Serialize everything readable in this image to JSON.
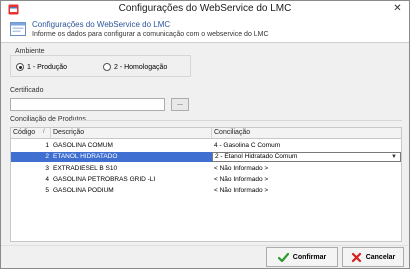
{
  "window": {
    "title": "Configurações do WebService do LMC",
    "close_glyph": "✕"
  },
  "header": {
    "title": "Configurações do WebService do LMC",
    "subtitle": "Informe os dados para configurar a comunicação com o webservice do LMC",
    "icon": "window-form-icon"
  },
  "ambiente": {
    "label": "Ambiente",
    "options": [
      {
        "label": "1 - Produção",
        "checked": true
      },
      {
        "label": "2 - Homologação",
        "checked": false
      }
    ]
  },
  "certificado": {
    "label": "Certificado",
    "value": "",
    "browse_label": "..."
  },
  "conciliacao": {
    "section_label": "Conciliação de Produtos",
    "columns": [
      "Código",
      "/",
      "Descrição",
      "Conciliação"
    ],
    "rows": [
      {
        "code": "1",
        "description": "GASOLINA COMUM",
        "conciliacao": "4 - Gasolina C Comum",
        "selected": false
      },
      {
        "code": "2",
        "description": "ETANOL HIDRATADO",
        "conciliacao": "2 - Etanol Hidratado Comum",
        "selected": true
      },
      {
        "code": "3",
        "description": "EXTRADIESEL B S10",
        "conciliacao": "< Não Informado >",
        "selected": false
      },
      {
        "code": "4",
        "description": "GASOLINA PETROBRAS GRID -LI",
        "conciliacao": "< Não Informado >",
        "selected": false
      },
      {
        "code": "5",
        "description": "GASOLINA PODIUM",
        "conciliacao": "< Não Informado >",
        "selected": false
      }
    ]
  },
  "buttons": {
    "confirm_label": "Confirmar",
    "cancel_label": "Cancelar"
  },
  "colors": {
    "header_title": "#2a5599",
    "selection": "#3e6fd1",
    "confirm_icon": "#2e9a2e",
    "cancel_icon": "#d42020"
  }
}
